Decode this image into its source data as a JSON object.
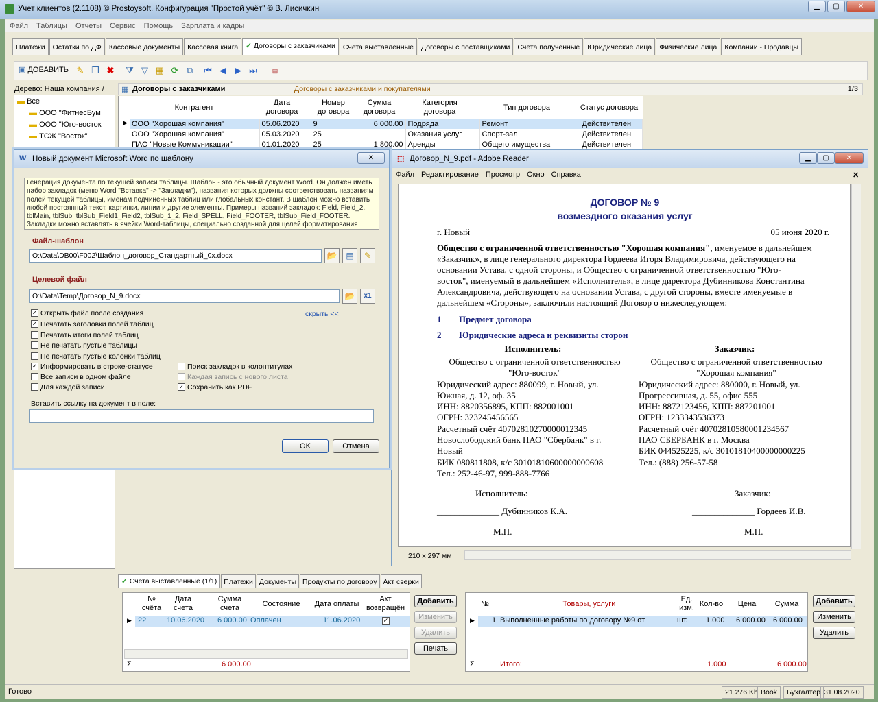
{
  "app": {
    "title": "Учет клиентов (2.1108) © Prostoysoft. Конфигурация \"Простой учёт\" © В. Лисичкин"
  },
  "menu": [
    "Файл",
    "Таблицы",
    "Отчеты",
    "Сервис",
    "Помощь",
    "Зарплата и кадры"
  ],
  "tabs": [
    "Платежи",
    "Остатки по ДФ",
    "Кассовые документы",
    "Кассовая книга",
    "Договоры с заказчиками",
    "Счета выставленные",
    "Договоры с поставщиками",
    "Счета полученные",
    "Юридические лица",
    "Физические лица",
    "Компании - Продавцы"
  ],
  "toolbar": {
    "add_label": "ДОБАВИТЬ"
  },
  "tree": {
    "header": "Дерево: Наша компания /",
    "items": [
      "Все",
      "ООО \"ФитнесБум",
      "ООО \"Юго-восток",
      "ТСЖ \"Восток\""
    ]
  },
  "grid": {
    "title": "Договоры с заказчиками",
    "subtitle": "Договоры с заказчиками и покупателями",
    "page": "1/3",
    "headers": [
      "Контрагент",
      "Дата договора",
      "Номер договора",
      "Сумма договора",
      "Категория договора",
      "Тип договора",
      "Статус договора"
    ],
    "rows": [
      [
        "ООО \"Хорошая компания\"",
        "05.06.2020",
        "9",
        "6 000.00",
        "Подряда",
        "Ремонт",
        "Действителен"
      ],
      [
        "ООО \"Хорошая компания\"",
        "05.03.2020",
        "25",
        "",
        "Оказания услуг",
        "Спорт-зал",
        "Действителен"
      ],
      [
        "ПАО \"Новые Коммуникации\"",
        "01.01.2020",
        "25",
        "1 800.00",
        "Аренды",
        "Общего имущества",
        "Действителен"
      ]
    ]
  },
  "dialog": {
    "title": "Новый документ Microsoft Word по шаблону",
    "info": "Генерация документа по текущей записи таблицы. Шаблон - это обычный документ Word. Он должен иметь набор закладок (меню Word \"Вставка\" -> \"Закладки\"), названия которых должны соответствовать названиям полей текущей таблицы, именам подчиненных таблиц или глобальных констант. В шаблон можно вставить любой постоянный текст, картинки, линии и другие элементы. Примеры названий закладок: Field, Field_2, tblMain, tblSub, tblSub_Field1_Field2, tblSub_1_2, Field_SPELL, Field_FOOTER, tblSub_Field_FOOTER. Закладки можно вставлять в ячейки Word-таблицы, специально созданной для целей форматирования",
    "template_label": "Файл-шаблон",
    "template_path": "O:\\Data\\DB00\\F002\\Шаблон_договор_Стандартный_0x.docx",
    "target_label": "Целевой файл",
    "target_path": "O:\\Data\\Temp\\Договор_N_9.docx",
    "hide_link": "скрыть <<",
    "checks_left": [
      {
        "label": "Открыть файл после создания",
        "checked": true
      },
      {
        "label": "Печатать заголовки полей таблиц",
        "checked": true
      },
      {
        "label": "Печатать итоги полей таблиц",
        "checked": false
      },
      {
        "label": "Не печатать пустые таблицы",
        "checked": false
      },
      {
        "label": "Не печатать пустые колонки таблиц",
        "checked": false
      },
      {
        "label": "Информировать в строке-статусе",
        "checked": true
      },
      {
        "label": "Все записи в одном файле",
        "checked": false
      },
      {
        "label": "Для каждой записи",
        "checked": false
      }
    ],
    "checks_right": [
      {
        "label": "Поиск закладок в колонтитулах",
        "checked": false
      },
      {
        "label": "Каждая запись с нового листа",
        "checked": false
      },
      {
        "label": "Сохранить как PDF",
        "checked": true
      }
    ],
    "link_label": "Вставить ссылку на документ в поле:",
    "ok": "OK",
    "cancel": "Отмена"
  },
  "reader": {
    "title": "Договор_N_9.pdf - Adobe Reader",
    "menu": [
      "Файл",
      "Редактирование",
      "Просмотр",
      "Окно",
      "Справка"
    ],
    "page_size": "210 x 297 мм"
  },
  "pdf": {
    "title": "ДОГОВОР № 9",
    "subtitle": "возмездного оказания услуг",
    "city": "г. Новый",
    "date": "05 июня 2020 г.",
    "para_bold1": "Общество с ограниченной ответственностью \"Хорошая компания\"",
    "para_rest1": ", именуемое в дальнейшем",
    "para2": "«Заказчик», в лице генерального директора Гордеева Игоря Владимировича, действующего на",
    "para3": "основании Устава, с одной стороны, и Общество с ограниченной ответственностью \"Юго-",
    "para4": "восток\", именуемый в дальнейшем «Исполнитель», в лице директора Дубинникова Константина",
    "para5": "Александровича, действующего на основании Устава, с другой стороны, вместе именуемые в",
    "para6": "дальнейшем «Стороны», заключили настоящий Договор о нижеследующем:",
    "sec1_num": "1",
    "sec1": "Предмет договора",
    "sec2_num": "2",
    "sec2": "Юридические адреса и реквизиты сторон",
    "left_head": "Исполнитель:",
    "right_head": "Заказчик:",
    "left_lines": [
      "Общество с ограниченной ответственностью",
      "\"Юго-восток\"",
      "Юридический адрес: 880099, г. Новый, ул.",
      "Южная, д. 12, оф. 35",
      "ИНН: 8820356895, КПП: 882001001",
      "ОГРН: 323245456565",
      "Расчетный счёт 40702810270000012345",
      "Новослободский банк ПАО \"Сбербанк\" в г.",
      "Новый",
      "БИК 080811808, к/с 30101810600000000608",
      "Тел.: 252-46-97, 999-888-7766"
    ],
    "right_lines": [
      "Общество с ограниченной ответственностью",
      "\"Хорошая компания\"",
      "Юридический адрес: 880000, г. Новый, ул.",
      "Прогрессивная, д. 55, офис 555",
      "ИНН: 8872123456, КПП: 887201001",
      "ОГРН: 1233343536373",
      "Расчетный счёт 40702810580001234567",
      "ПАО СБЕРБАНК в г. Москва",
      "БИК 044525225, к/с 30101810400000000225",
      "Тел.: (888) 256-57-58"
    ],
    "sign_left": "Исполнитель:",
    "sign_right": "Заказчик:",
    "sign_left_name": "______________ Дубинников К.А.",
    "sign_right_name": "______________ Гордеев И.В.",
    "mp": "М.П."
  },
  "bottom_tabs": [
    "Счета выставленные (1/1)",
    "Платежи",
    "Документы",
    "Продукты по договору",
    "Акт сверки"
  ],
  "invoices": {
    "headers": [
      "№ счёта",
      "Дата счета",
      "Сумма счета",
      "Состояние",
      "Дата оплаты",
      "Акт возвращён"
    ],
    "row": [
      "22",
      "10.06.2020",
      "6 000.00",
      "Оплачен",
      "11.06.2020"
    ],
    "total": "6 000.00"
  },
  "inv_buttons": [
    "Добавить",
    "Изменить",
    "Удалить",
    "Печать"
  ],
  "items": {
    "headers": [
      "№",
      "Товары, услуги",
      "Ед. изм.",
      "Кол-во",
      "Цена",
      "Сумма"
    ],
    "row": [
      "1",
      "Выполненные работы по договору №9 от",
      "шт.",
      "1.000",
      "6 000.00",
      "6 000.00"
    ],
    "total_label": "Итого:",
    "total_qty": "1.000",
    "total_sum": "6 000.00"
  },
  "item_buttons": [
    "Добавить",
    "Изменить",
    "Удалить"
  ],
  "sigma": "Σ",
  "status": {
    "left": "Готово",
    "mem": "21 276 Kb",
    "book": "Book",
    "user": "Бухгалтер",
    "date": "31.08.2020"
  }
}
